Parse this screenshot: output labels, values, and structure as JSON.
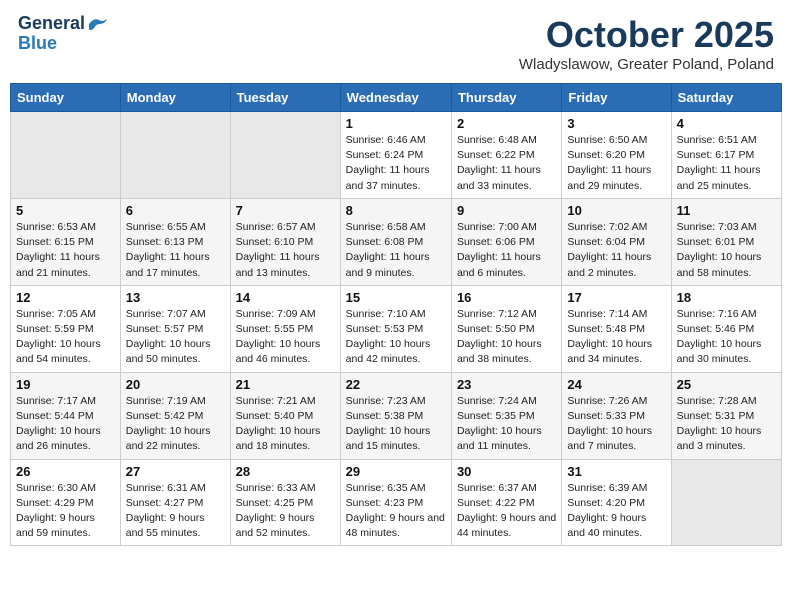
{
  "header": {
    "logo_line1": "General",
    "logo_line2": "Blue",
    "month_title": "October 2025",
    "location": "Wladyslawow, Greater Poland, Poland"
  },
  "days_of_week": [
    "Sunday",
    "Monday",
    "Tuesday",
    "Wednesday",
    "Thursday",
    "Friday",
    "Saturday"
  ],
  "weeks": [
    [
      {
        "day": "",
        "sunrise": "",
        "sunset": "",
        "daylight": ""
      },
      {
        "day": "",
        "sunrise": "",
        "sunset": "",
        "daylight": ""
      },
      {
        "day": "",
        "sunrise": "",
        "sunset": "",
        "daylight": ""
      },
      {
        "day": "1",
        "sunrise": "Sunrise: 6:46 AM",
        "sunset": "Sunset: 6:24 PM",
        "daylight": "Daylight: 11 hours and 37 minutes."
      },
      {
        "day": "2",
        "sunrise": "Sunrise: 6:48 AM",
        "sunset": "Sunset: 6:22 PM",
        "daylight": "Daylight: 11 hours and 33 minutes."
      },
      {
        "day": "3",
        "sunrise": "Sunrise: 6:50 AM",
        "sunset": "Sunset: 6:20 PM",
        "daylight": "Daylight: 11 hours and 29 minutes."
      },
      {
        "day": "4",
        "sunrise": "Sunrise: 6:51 AM",
        "sunset": "Sunset: 6:17 PM",
        "daylight": "Daylight: 11 hours and 25 minutes."
      }
    ],
    [
      {
        "day": "5",
        "sunrise": "Sunrise: 6:53 AM",
        "sunset": "Sunset: 6:15 PM",
        "daylight": "Daylight: 11 hours and 21 minutes."
      },
      {
        "day": "6",
        "sunrise": "Sunrise: 6:55 AM",
        "sunset": "Sunset: 6:13 PM",
        "daylight": "Daylight: 11 hours and 17 minutes."
      },
      {
        "day": "7",
        "sunrise": "Sunrise: 6:57 AM",
        "sunset": "Sunset: 6:10 PM",
        "daylight": "Daylight: 11 hours and 13 minutes."
      },
      {
        "day": "8",
        "sunrise": "Sunrise: 6:58 AM",
        "sunset": "Sunset: 6:08 PM",
        "daylight": "Daylight: 11 hours and 9 minutes."
      },
      {
        "day": "9",
        "sunrise": "Sunrise: 7:00 AM",
        "sunset": "Sunset: 6:06 PM",
        "daylight": "Daylight: 11 hours and 6 minutes."
      },
      {
        "day": "10",
        "sunrise": "Sunrise: 7:02 AM",
        "sunset": "Sunset: 6:04 PM",
        "daylight": "Daylight: 11 hours and 2 minutes."
      },
      {
        "day": "11",
        "sunrise": "Sunrise: 7:03 AM",
        "sunset": "Sunset: 6:01 PM",
        "daylight": "Daylight: 10 hours and 58 minutes."
      }
    ],
    [
      {
        "day": "12",
        "sunrise": "Sunrise: 7:05 AM",
        "sunset": "Sunset: 5:59 PM",
        "daylight": "Daylight: 10 hours and 54 minutes."
      },
      {
        "day": "13",
        "sunrise": "Sunrise: 7:07 AM",
        "sunset": "Sunset: 5:57 PM",
        "daylight": "Daylight: 10 hours and 50 minutes."
      },
      {
        "day": "14",
        "sunrise": "Sunrise: 7:09 AM",
        "sunset": "Sunset: 5:55 PM",
        "daylight": "Daylight: 10 hours and 46 minutes."
      },
      {
        "day": "15",
        "sunrise": "Sunrise: 7:10 AM",
        "sunset": "Sunset: 5:53 PM",
        "daylight": "Daylight: 10 hours and 42 minutes."
      },
      {
        "day": "16",
        "sunrise": "Sunrise: 7:12 AM",
        "sunset": "Sunset: 5:50 PM",
        "daylight": "Daylight: 10 hours and 38 minutes."
      },
      {
        "day": "17",
        "sunrise": "Sunrise: 7:14 AM",
        "sunset": "Sunset: 5:48 PM",
        "daylight": "Daylight: 10 hours and 34 minutes."
      },
      {
        "day": "18",
        "sunrise": "Sunrise: 7:16 AM",
        "sunset": "Sunset: 5:46 PM",
        "daylight": "Daylight: 10 hours and 30 minutes."
      }
    ],
    [
      {
        "day": "19",
        "sunrise": "Sunrise: 7:17 AM",
        "sunset": "Sunset: 5:44 PM",
        "daylight": "Daylight: 10 hours and 26 minutes."
      },
      {
        "day": "20",
        "sunrise": "Sunrise: 7:19 AM",
        "sunset": "Sunset: 5:42 PM",
        "daylight": "Daylight: 10 hours and 22 minutes."
      },
      {
        "day": "21",
        "sunrise": "Sunrise: 7:21 AM",
        "sunset": "Sunset: 5:40 PM",
        "daylight": "Daylight: 10 hours and 18 minutes."
      },
      {
        "day": "22",
        "sunrise": "Sunrise: 7:23 AM",
        "sunset": "Sunset: 5:38 PM",
        "daylight": "Daylight: 10 hours and 15 minutes."
      },
      {
        "day": "23",
        "sunrise": "Sunrise: 7:24 AM",
        "sunset": "Sunset: 5:35 PM",
        "daylight": "Daylight: 10 hours and 11 minutes."
      },
      {
        "day": "24",
        "sunrise": "Sunrise: 7:26 AM",
        "sunset": "Sunset: 5:33 PM",
        "daylight": "Daylight: 10 hours and 7 minutes."
      },
      {
        "day": "25",
        "sunrise": "Sunrise: 7:28 AM",
        "sunset": "Sunset: 5:31 PM",
        "daylight": "Daylight: 10 hours and 3 minutes."
      }
    ],
    [
      {
        "day": "26",
        "sunrise": "Sunrise: 6:30 AM",
        "sunset": "Sunset: 4:29 PM",
        "daylight": "Daylight: 9 hours and 59 minutes."
      },
      {
        "day": "27",
        "sunrise": "Sunrise: 6:31 AM",
        "sunset": "Sunset: 4:27 PM",
        "daylight": "Daylight: 9 hours and 55 minutes."
      },
      {
        "day": "28",
        "sunrise": "Sunrise: 6:33 AM",
        "sunset": "Sunset: 4:25 PM",
        "daylight": "Daylight: 9 hours and 52 minutes."
      },
      {
        "day": "29",
        "sunrise": "Sunrise: 6:35 AM",
        "sunset": "Sunset: 4:23 PM",
        "daylight": "Daylight: 9 hours and 48 minutes."
      },
      {
        "day": "30",
        "sunrise": "Sunrise: 6:37 AM",
        "sunset": "Sunset: 4:22 PM",
        "daylight": "Daylight: 9 hours and 44 minutes."
      },
      {
        "day": "31",
        "sunrise": "Sunrise: 6:39 AM",
        "sunset": "Sunset: 4:20 PM",
        "daylight": "Daylight: 9 hours and 40 minutes."
      },
      {
        "day": "",
        "sunrise": "",
        "sunset": "",
        "daylight": ""
      }
    ]
  ]
}
